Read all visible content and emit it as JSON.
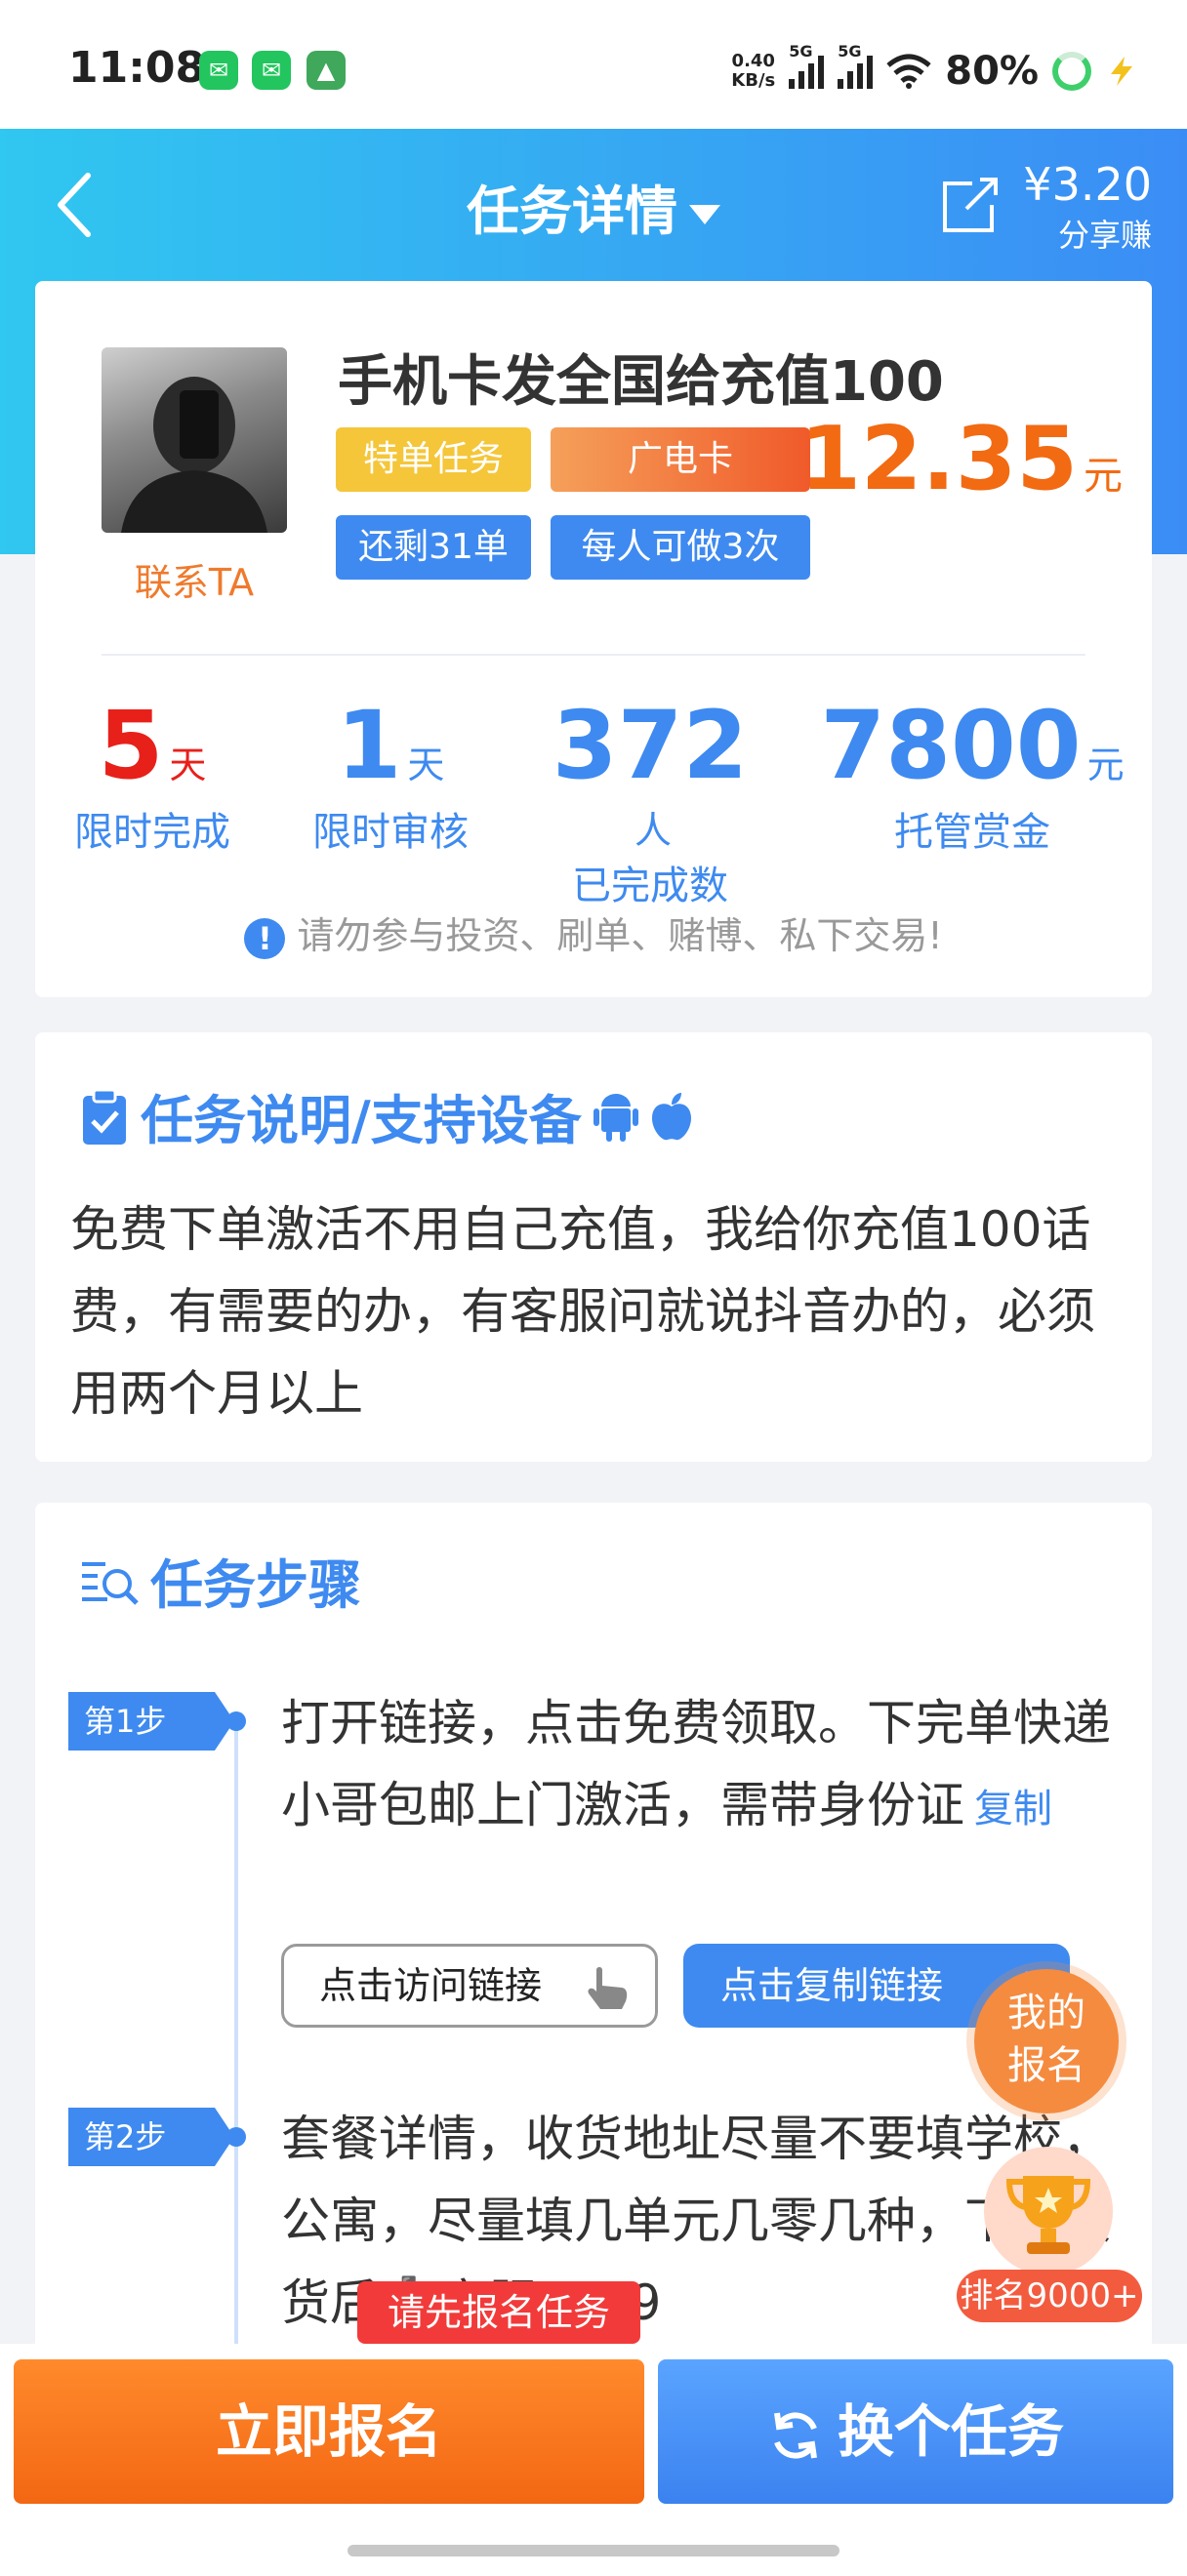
{
  "status_bar": {
    "time": "11:08",
    "speed_value": "0.40",
    "speed_unit": "KB/s",
    "net1": "5G",
    "net2": "5G",
    "battery": "80%"
  },
  "header": {
    "title": "任务详情",
    "share_amount": "¥3.20",
    "share_label": "分享赚"
  },
  "task": {
    "name": "手机卡发全国给充值100",
    "contact_label": "联系TA",
    "tags": [
      "特单任务",
      "广电卡",
      "还剩31单",
      "每人可做3次"
    ],
    "price": "12.35",
    "price_unit": "元",
    "stats": [
      {
        "value": "5",
        "unit": "天",
        "label": "限时完成"
      },
      {
        "value": "1",
        "unit": "天",
        "label": "限时审核"
      },
      {
        "value": "372",
        "unit": "人",
        "label": "已完成数"
      },
      {
        "value": "7800",
        "unit": "元",
        "label": "托管赏金"
      }
    ],
    "warning": "请勿参与投资、刷单、赌博、私下交易!"
  },
  "description": {
    "title": "任务说明/支持设备",
    "text": "免费下单激活不用自己充值，我给你充值100话费，有需要的办，有客服问就说抖音办的，必须用两个月以上"
  },
  "steps": {
    "title": "任务步骤",
    "items": [
      {
        "badge": "第1步",
        "text": "打开链接，点击免费领取。下完单快递小哥包邮上门激活，需带身份证",
        "copy": "复制",
        "visit_button": "点击访问链接",
        "copy_button": "点击复制链接"
      },
      {
        "badge": "第2步",
        "text": "套餐详情，收货地址尽量不要填学校，公寓，尽量填几单元几零几种，下单发货后➕客服qq29"
      }
    ]
  },
  "floating": {
    "my_signup": "我的报名",
    "rank": "排名9000+"
  },
  "tooltip": "请先报名任务",
  "bottom": {
    "signup": "立即报名",
    "switch": "换个任务"
  }
}
